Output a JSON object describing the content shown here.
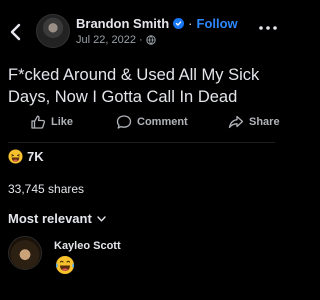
{
  "header": {
    "back_icon": "chevron-left-icon",
    "author": "Brandon Smith",
    "verified_icon": "verified-badge-icon",
    "separator": "·",
    "follow_label": "Follow",
    "date": "Jul 22, 2022",
    "meta_separator": "·",
    "privacy_icon": "globe-icon",
    "more_icon": "more-horizontal-icon"
  },
  "post": {
    "text": "F*cked Around & Used All My Sick Days, Now I Gotta Call In Dead"
  },
  "actions": {
    "like_label": "Like",
    "comment_label": "Comment",
    "share_label": "Share"
  },
  "stats": {
    "reaction_icon": "haha-emoji-icon",
    "reaction_count": "7K",
    "shares": "33,745 shares"
  },
  "comments": {
    "sort_label": "Most relevant",
    "items": [
      {
        "author": "Kayleo Scott",
        "content_icon": "laughing-tears-emoji-icon"
      }
    ]
  },
  "colors": {
    "background": "#000000",
    "text": "#e4e6eb",
    "muted": "#9aa0a6",
    "link": "#2d88ff",
    "verified": "#1877f2"
  }
}
